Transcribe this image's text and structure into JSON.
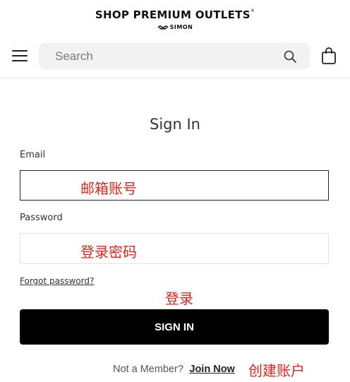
{
  "brand": {
    "name": "SHOP PREMIUM OUTLETS",
    "trademark": "®",
    "sub": "SIMON"
  },
  "header": {
    "search_placeholder": "Search"
  },
  "form": {
    "title": "Sign In",
    "email_label": "Email",
    "email_value": "",
    "password_label": "Password",
    "password_value": "",
    "forgot_label": "Forgot password?",
    "signin_label": "SIGN IN",
    "member_text": "Not a Member?",
    "join_label": "Join Now"
  },
  "annotations": {
    "email": "邮箱账号",
    "password": "登录密码",
    "signin": "登录",
    "join": "创建账户",
    "color": "#e0251b"
  }
}
